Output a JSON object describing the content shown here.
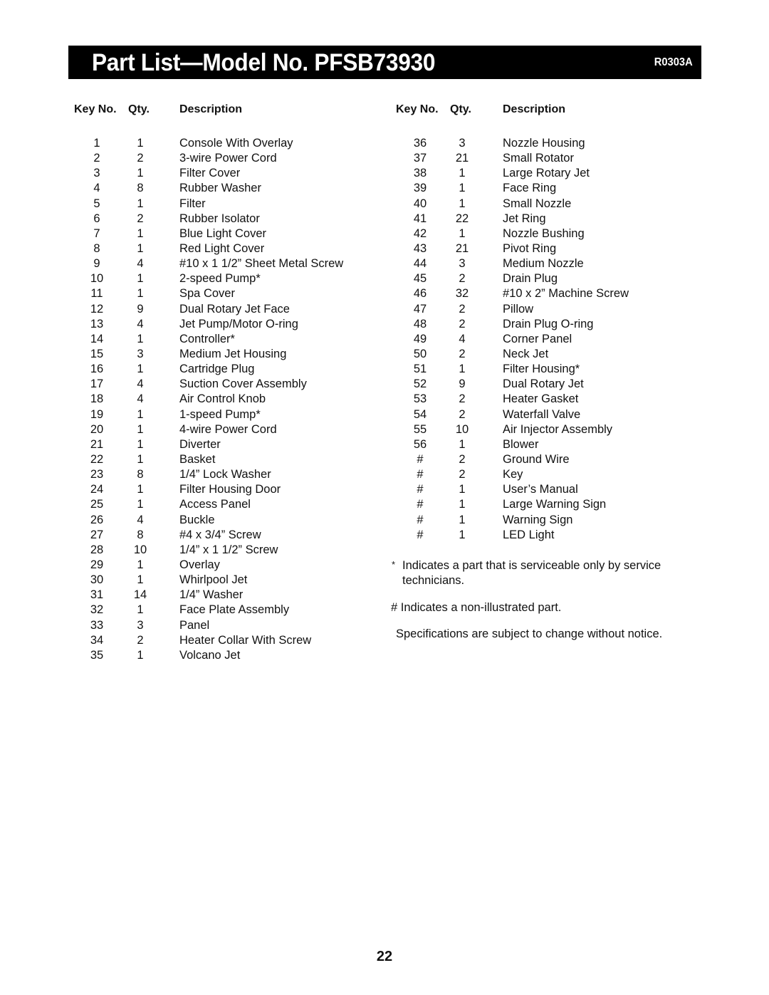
{
  "header": {
    "title": "Part List—Model No. PFSB73930",
    "code": "R0303A"
  },
  "columns": {
    "key": "Key No.",
    "qty": "Qty.",
    "description": "Description"
  },
  "parts_left": [
    {
      "key": "1",
      "qty": "1",
      "desc": "Console With Overlay"
    },
    {
      "key": "2",
      "qty": "2",
      "desc": "3-wire Power Cord"
    },
    {
      "key": "3",
      "qty": "1",
      "desc": "Filter Cover"
    },
    {
      "key": "4",
      "qty": "8",
      "desc": "Rubber Washer"
    },
    {
      "key": "5",
      "qty": "1",
      "desc": "Filter"
    },
    {
      "key": "6",
      "qty": "2",
      "desc": "Rubber Isolator"
    },
    {
      "key": "7",
      "qty": "1",
      "desc": "Blue Light Cover"
    },
    {
      "key": "8",
      "qty": "1",
      "desc": "Red Light Cover"
    },
    {
      "key": "9",
      "qty": "4",
      "desc": "#10 x 1 1/2” Sheet Metal Screw"
    },
    {
      "key": "10",
      "qty": "1",
      "desc": "2-speed Pump*"
    },
    {
      "key": "11",
      "qty": "1",
      "desc": "Spa Cover"
    },
    {
      "key": "12",
      "qty": "9",
      "desc": "Dual Rotary Jet Face"
    },
    {
      "key": "13",
      "qty": "4",
      "desc": "Jet Pump/Motor O-ring"
    },
    {
      "key": "14",
      "qty": "1",
      "desc": "Controller*"
    },
    {
      "key": "15",
      "qty": "3",
      "desc": "Medium Jet Housing"
    },
    {
      "key": "16",
      "qty": "1",
      "desc": "Cartridge Plug"
    },
    {
      "key": "17",
      "qty": "4",
      "desc": "Suction Cover Assembly"
    },
    {
      "key": "18",
      "qty": "4",
      "desc": "Air Control Knob"
    },
    {
      "key": "19",
      "qty": "1",
      "desc": "1-speed Pump*"
    },
    {
      "key": "20",
      "qty": "1",
      "desc": "4-wire Power Cord"
    },
    {
      "key": "21",
      "qty": "1",
      "desc": "Diverter"
    },
    {
      "key": "22",
      "qty": "1",
      "desc": "Basket"
    },
    {
      "key": "23",
      "qty": "8",
      "desc": "1/4” Lock Washer"
    },
    {
      "key": "24",
      "qty": "1",
      "desc": "Filter Housing Door"
    },
    {
      "key": "25",
      "qty": "1",
      "desc": "Access Panel"
    },
    {
      "key": "26",
      "qty": "4",
      "desc": "Buckle"
    },
    {
      "key": "27",
      "qty": "8",
      "desc": "#4 x 3/4” Screw"
    },
    {
      "key": "28",
      "qty": "10",
      "desc": "1/4” x 1 1/2” Screw"
    },
    {
      "key": "29",
      "qty": "1",
      "desc": "Overlay"
    },
    {
      "key": "30",
      "qty": "1",
      "desc": "Whirlpool Jet"
    },
    {
      "key": "31",
      "qty": "14",
      "desc": "1/4” Washer"
    },
    {
      "key": "32",
      "qty": "1",
      "desc": "Face Plate Assembly"
    },
    {
      "key": "33",
      "qty": "3",
      "desc": "Panel"
    },
    {
      "key": "34",
      "qty": "2",
      "desc": "Heater Collar With Screw"
    },
    {
      "key": "35",
      "qty": "1",
      "desc": "Volcano Jet"
    }
  ],
  "parts_right": [
    {
      "key": "36",
      "qty": "3",
      "desc": "Nozzle Housing"
    },
    {
      "key": "37",
      "qty": "21",
      "desc": "Small Rotator"
    },
    {
      "key": "38",
      "qty": "1",
      "desc": "Large Rotary Jet"
    },
    {
      "key": "39",
      "qty": "1",
      "desc": "Face Ring"
    },
    {
      "key": "40",
      "qty": "1",
      "desc": "Small Nozzle"
    },
    {
      "key": "41",
      "qty": "22",
      "desc": "Jet Ring"
    },
    {
      "key": "42",
      "qty": "1",
      "desc": "Nozzle Bushing"
    },
    {
      "key": "43",
      "qty": "21",
      "desc": "Pivot Ring"
    },
    {
      "key": "44",
      "qty": "3",
      "desc": "Medium Nozzle"
    },
    {
      "key": "45",
      "qty": "2",
      "desc": "Drain Plug"
    },
    {
      "key": "46",
      "qty": "32",
      "desc": "#10 x 2” Machine Screw"
    },
    {
      "key": "47",
      "qty": "2",
      "desc": "Pillow"
    },
    {
      "key": "48",
      "qty": "2",
      "desc": "Drain Plug O-ring"
    },
    {
      "key": "49",
      "qty": "4",
      "desc": "Corner Panel"
    },
    {
      "key": "50",
      "qty": "2",
      "desc": "Neck Jet"
    },
    {
      "key": "51",
      "qty": "1",
      "desc": "Filter Housing*"
    },
    {
      "key": "52",
      "qty": "9",
      "desc": "Dual Rotary Jet"
    },
    {
      "key": "53",
      "qty": "2",
      "desc": "Heater Gasket"
    },
    {
      "key": "54",
      "qty": "2",
      "desc": "Waterfall Valve"
    },
    {
      "key": "55",
      "qty": "10",
      "desc": "Air Injector Assembly"
    },
    {
      "key": "56",
      "qty": "1",
      "desc": "Blower"
    },
    {
      "key": "#",
      "qty": "2",
      "desc": "Ground Wire"
    },
    {
      "key": "#",
      "qty": "2",
      "desc": "Key"
    },
    {
      "key": "#",
      "qty": "1",
      "desc": "User’s Manual"
    },
    {
      "key": "#",
      "qty": "1",
      "desc": "Large Warning Sign"
    },
    {
      "key": "#",
      "qty": "1",
      "desc": "Warning Sign"
    },
    {
      "key": "#",
      "qty": "1",
      "desc": "LED Light"
    }
  ],
  "notes": {
    "star_mark": "*",
    "star_text": "Indicates a part that is serviceable only by service technicians.",
    "hash_text": "# Indicates a non-illustrated part.",
    "spec_text": "Specifications are subject to change without notice."
  },
  "page_number": "22"
}
